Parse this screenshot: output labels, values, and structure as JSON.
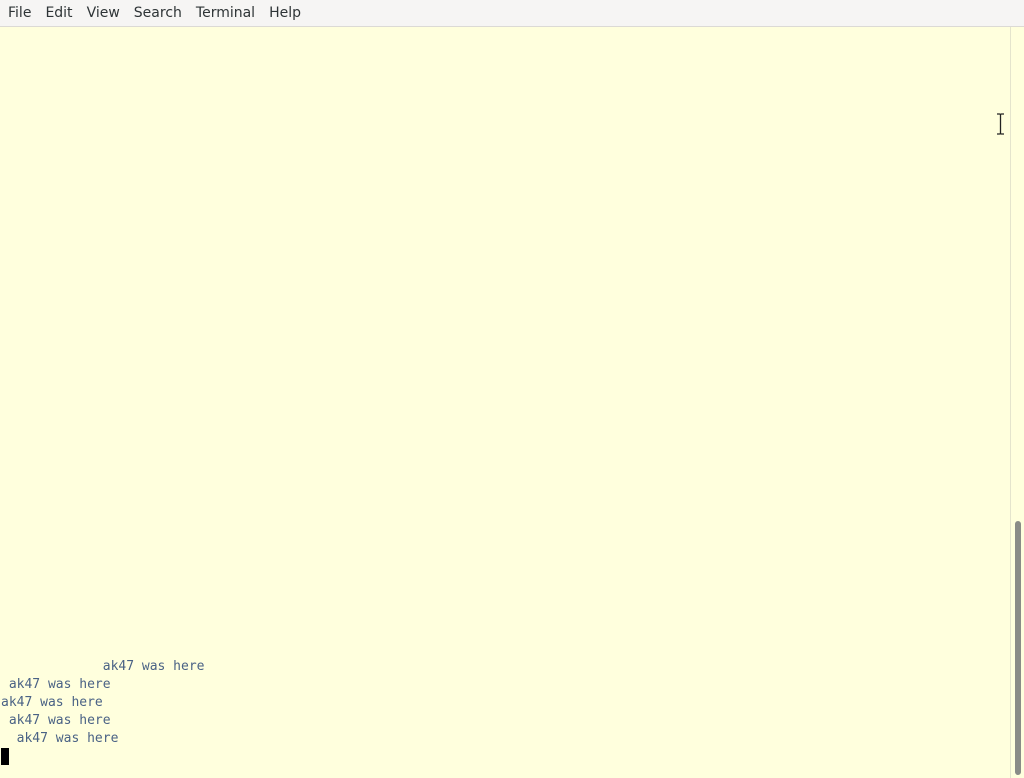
{
  "menubar": {
    "items": [
      {
        "label": "File"
      },
      {
        "label": "Edit"
      },
      {
        "label": "View"
      },
      {
        "label": "Search"
      },
      {
        "label": "Terminal"
      },
      {
        "label": "Help"
      }
    ]
  },
  "terminal": {
    "lines": [
      "             ak47 was here",
      " ak47 was here",
      "ak47 was here",
      " ak47 was here",
      "  ak47 was here"
    ]
  },
  "icons": {
    "mouse_pointer": "ibeam-cursor-icon"
  }
}
